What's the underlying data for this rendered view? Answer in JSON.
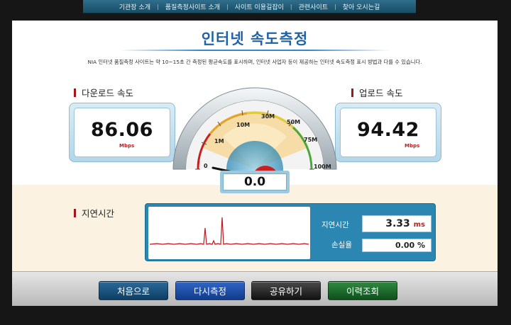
{
  "nav": {
    "items": [
      "기관장 소개",
      "품질측정사이트 소개",
      "사이트 이용길잡이",
      "관련사이트",
      "찾아 오시는길"
    ],
    "separator": "|"
  },
  "page": {
    "title": "인터넷 속도측정",
    "description": "NIA 인터넷 품질측정 사이트는 약 10~15초 간 측정된 평균속도를 표시하며, 인터넷 사업자 등이 제공하는 인터넷 속도측정 표시 방법과 다를 수 있습니다."
  },
  "download": {
    "label": "다운로드 속도",
    "value": "86.06",
    "unit": "Mbps"
  },
  "upload": {
    "label": "업로드 속도",
    "value": "94.42",
    "unit": "Mbps"
  },
  "gauge": {
    "ticks": [
      "0",
      "1M",
      "10M",
      "30M",
      "50M",
      "75M",
      "100M"
    ],
    "readout": "0.0",
    "needle_value": 0
  },
  "latency": {
    "section_label": "지연시간",
    "delay_label": "지연시간",
    "delay_value": "3.33",
    "delay_unit": "ms",
    "loss_label": "손실율",
    "loss_value": "0.00",
    "loss_unit": "%"
  },
  "buttons": {
    "home": "처음으로",
    "remeasure": "다시측정",
    "share": "공유하기",
    "history": "이력조회"
  },
  "colors": {
    "title": "#1f63a6",
    "accent_red": "#a3141b",
    "panel_blue": "#2b86b2",
    "graph_line": "#c0141b"
  }
}
